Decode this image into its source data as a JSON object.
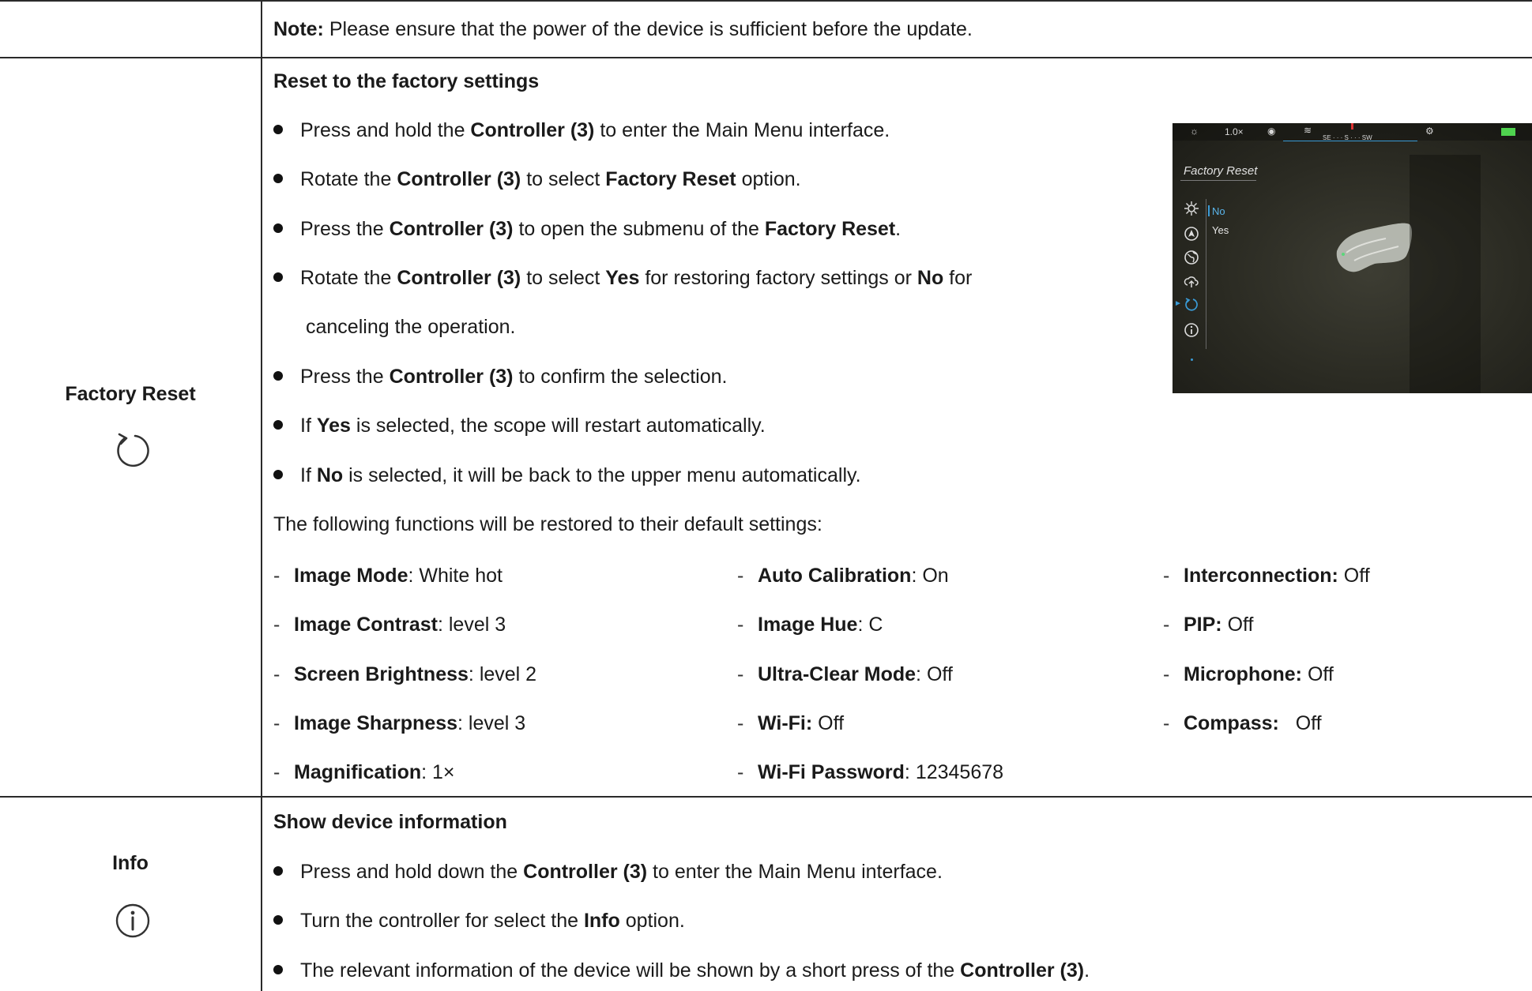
{
  "note": {
    "label": "Note:",
    "text": " Please ensure that the power of the device is sufficient before the update."
  },
  "factory_reset": {
    "section_name": "Factory Reset",
    "icon": "reset-icon",
    "heading": "Reset to the factory settings",
    "steps": [
      {
        "a": "Press and hold the ",
        "b": "Controller (3)",
        "c": " to enter the Main Menu interface."
      },
      {
        "a": "Rotate the ",
        "b": "Controller (3)",
        "c": " to select ",
        "d": "Factory Reset",
        "e": " option."
      },
      {
        "a": "Press the ",
        "b": "Controller (3)",
        "c": " to open the submenu of the ",
        "d": "Factory Reset",
        "e": "."
      },
      {
        "a": "Rotate the ",
        "b": "Controller (3)",
        "c": " to select ",
        "d": "Yes",
        "e": " for restoring factory settings or ",
        "f": "No",
        "g": " for",
        "cont": "canceling the operation."
      },
      {
        "a": "Press the ",
        "b": "Controller (3)",
        "c": " to confirm the selection."
      },
      {
        "a": "If ",
        "b": "Yes",
        "c": " is selected, the scope will restart automatically."
      },
      {
        "a": "If ",
        "b": "No",
        "c": " is selected, it will be back to the upper menu automatically."
      }
    ],
    "defaults_intro": "The following functions will be restored to their default settings:",
    "defaults": {
      "col1": [
        {
          "name": "Image Mode",
          "value": ": White hot"
        },
        {
          "name": "Image Contrast",
          "value": ": level 3"
        },
        {
          "name": "Screen Brightness",
          "value": ": level 2"
        },
        {
          "name": "Image Sharpness",
          "value": ": level 3"
        },
        {
          "name": "Magnification",
          "value": ": 1×"
        }
      ],
      "col2": [
        {
          "name": "Auto Calibration",
          "value": ": On"
        },
        {
          "name": "Image Hue",
          "value": ": C"
        },
        {
          "name": "Ultra-Clear Mode",
          "value": ": Off"
        },
        {
          "name": "Wi-Fi:",
          "value": " Off"
        },
        {
          "name": "Wi-Fi Password",
          "value": ": 12345678"
        }
      ],
      "col3": [
        {
          "name": "Interconnection:",
          "value": " Off"
        },
        {
          "name": "PIP:",
          "value": " Off"
        },
        {
          "name": "Microphone:",
          "value": " Off"
        },
        {
          "name": "Compass:",
          "value": "   Off"
        }
      ]
    },
    "device_screen": {
      "zoom": "1.0×",
      "compass": "SE · · · S · · · SW",
      "menu_title": "Factory Reset",
      "option_no": "No",
      "option_yes": "Yes"
    }
  },
  "info": {
    "section_name": "Info",
    "icon": "info-icon",
    "heading": "Show device information",
    "steps": [
      {
        "a": "Press and hold down the ",
        "b": "Controller (3)",
        "c": " to enter the Main Menu interface."
      },
      {
        "a": "Turn the controller for select the ",
        "b": "Info",
        "c": " option."
      },
      {
        "a": "The relevant information of the device will be shown by a short press of the ",
        "b": "Controller (3)",
        "c": "."
      }
    ]
  }
}
